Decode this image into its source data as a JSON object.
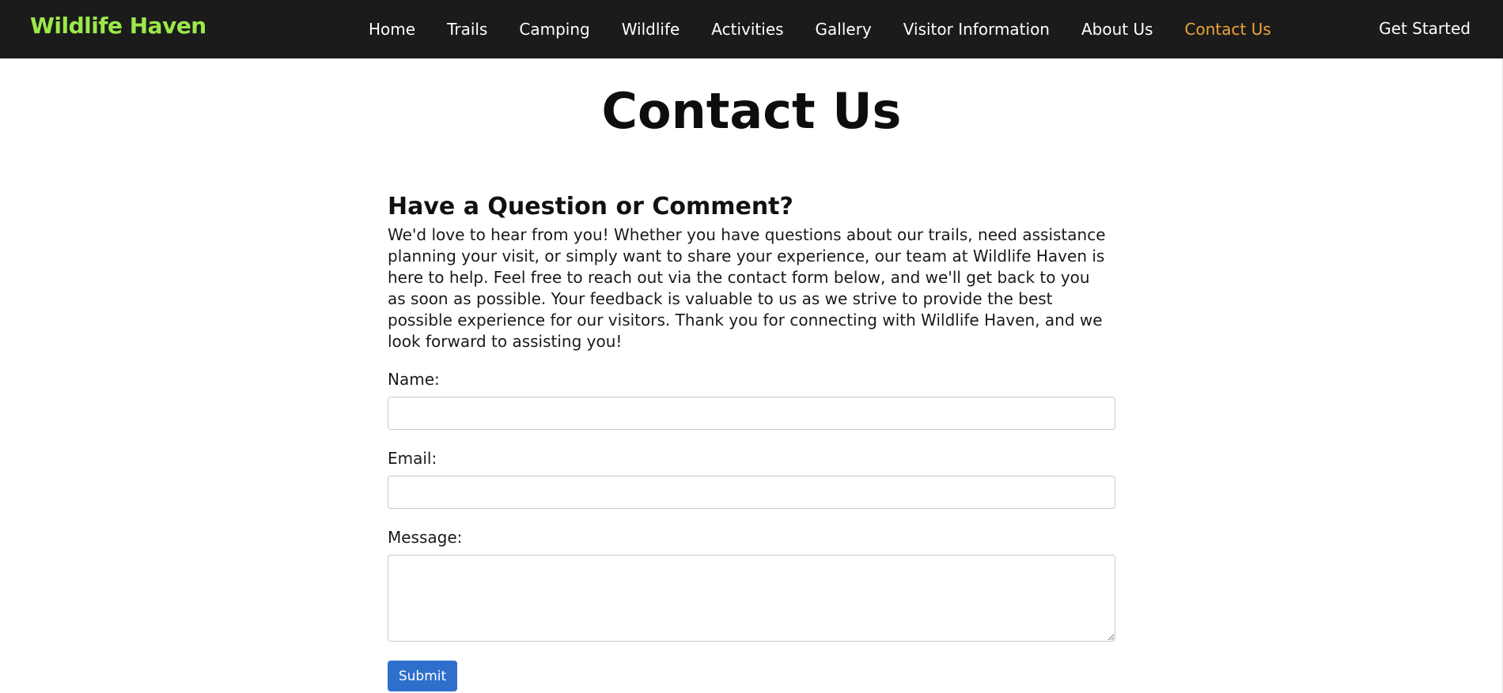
{
  "colors": {
    "nav_background": "#1b1b1b",
    "brand": "#9ce84a",
    "active_link": "#f0a33a",
    "submit_button": "#2e6fcc"
  },
  "header": {
    "brand": "Wildlife Haven",
    "nav_links": [
      "Home",
      "Trails",
      "Camping",
      "Wildlife",
      "Activities",
      "Gallery",
      "Visitor Information",
      "About Us",
      "Contact Us"
    ],
    "active_link": "Contact Us",
    "cta": "Get Started"
  },
  "page": {
    "title": "Contact Us"
  },
  "contact": {
    "heading": "Have a Question or Comment?",
    "intro": "We'd love to hear from you! Whether you have questions about our trails, need assistance planning your visit, or simply want to share your experience, our team at Wildlife Haven is here to help. Feel free to reach out via the contact form below, and we'll get back to you as soon as possible. Your feedback is valuable to us as we strive to provide the best possible experience for our visitors. Thank you for connecting with Wildlife Haven, and we look forward to assisting you!"
  },
  "form": {
    "name_label": "Name:",
    "name_value": "",
    "email_label": "Email:",
    "email_value": "",
    "message_label": "Message:",
    "message_value": "",
    "submit_label": "Submit"
  }
}
